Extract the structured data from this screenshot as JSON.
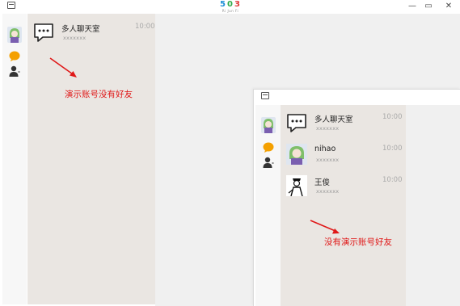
{
  "app": {
    "logo_digits": [
      "5",
      "0",
      "3"
    ],
    "logo_sub": "Ri Jun Fi",
    "window_controls": {
      "minimize": "—",
      "restore": "▭",
      "close": "✕"
    }
  },
  "main_window": {
    "chat_list": [
      {
        "name": "多人聊天室",
        "time": "10:00",
        "preview": "xxxxxxx",
        "icon": "group-chat-icon"
      }
    ],
    "annotation": "演示账号没有好友"
  },
  "inner_window": {
    "chat_list": [
      {
        "name": "多人聊天室",
        "time": "10:00",
        "preview": "xxxxxxx",
        "icon": "group-chat-icon"
      },
      {
        "name": "nihao",
        "time": "10:00",
        "preview": "xxxxxxx",
        "icon": "anime-avatar"
      },
      {
        "name": "王俊",
        "time": "10:00",
        "preview": "xxxxxxx",
        "icon": "sketch-avatar"
      }
    ],
    "annotation": "没有演示账号好友"
  },
  "colors": {
    "list_bg": "#eae6e2",
    "pane_bg": "#f0f0f0",
    "annotation": "#e01818",
    "chat_icon": "#f4a000"
  }
}
